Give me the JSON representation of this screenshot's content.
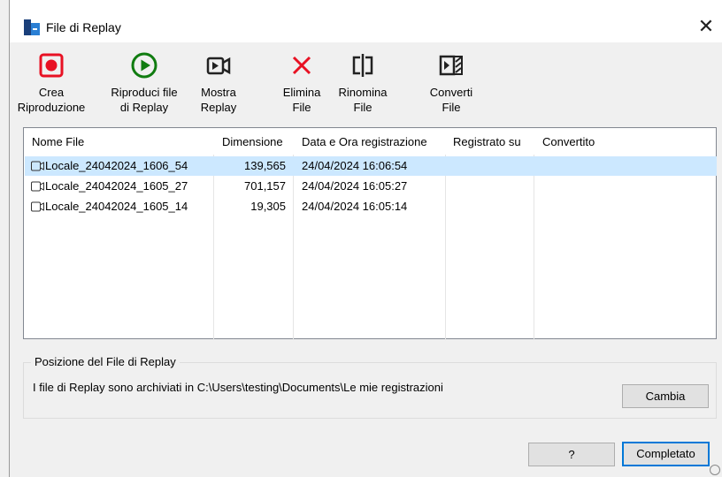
{
  "window": {
    "title": "File di Replay",
    "close_symbol": "✕"
  },
  "toolbar": [
    {
      "id": "crea",
      "lines": [
        "Crea",
        "Riproduzione"
      ],
      "icon": "record-icon",
      "color": "#e81123"
    },
    {
      "id": "riproduci",
      "lines": [
        "Riproduci file",
        "di Replay"
      ],
      "icon": "play-icon",
      "color": "#107c10"
    },
    {
      "id": "mostra",
      "lines": [
        "Mostra",
        "Replay"
      ],
      "icon": "video-camera-icon",
      "color": "#222222"
    },
    {
      "id": "elimina",
      "lines": [
        "Elimina",
        "File"
      ],
      "icon": "delete-x-icon",
      "color": "#e81123"
    },
    {
      "id": "rinomina",
      "lines": [
        "Rinomina",
        "File"
      ],
      "icon": "rename-icon",
      "color": "#222222"
    },
    {
      "id": "converti",
      "lines": [
        "Converti",
        "File"
      ],
      "icon": "convert-icon",
      "color": "#222222"
    }
  ],
  "file_list": {
    "columns": [
      "Nome File",
      "Dimensione",
      "Data e Ora registrazione",
      "Registrato su",
      "Convertito"
    ],
    "rows": [
      {
        "name": "Locale_24042024_1606_54",
        "size": "139,565",
        "datetime": "24/04/2024 16:06:54",
        "registered_on": "",
        "converted": "",
        "selected": true
      },
      {
        "name": "Locale_24042024_1605_27",
        "size": "701,157",
        "datetime": "24/04/2024 16:05:27",
        "registered_on": "",
        "converted": "",
        "selected": false
      },
      {
        "name": "Locale_24042024_1605_14",
        "size": "19,305",
        "datetime": "24/04/2024 16:05:14",
        "registered_on": "",
        "converted": "",
        "selected": false
      }
    ]
  },
  "location": {
    "group_title": "Posizione del File di Replay",
    "text": "I file di Replay sono archiviati in C:\\Users\\testing\\Documents\\Le mie registrazioni",
    "change_label": "Cambia"
  },
  "footer": {
    "help_label": "?",
    "done_label": "Completato"
  }
}
